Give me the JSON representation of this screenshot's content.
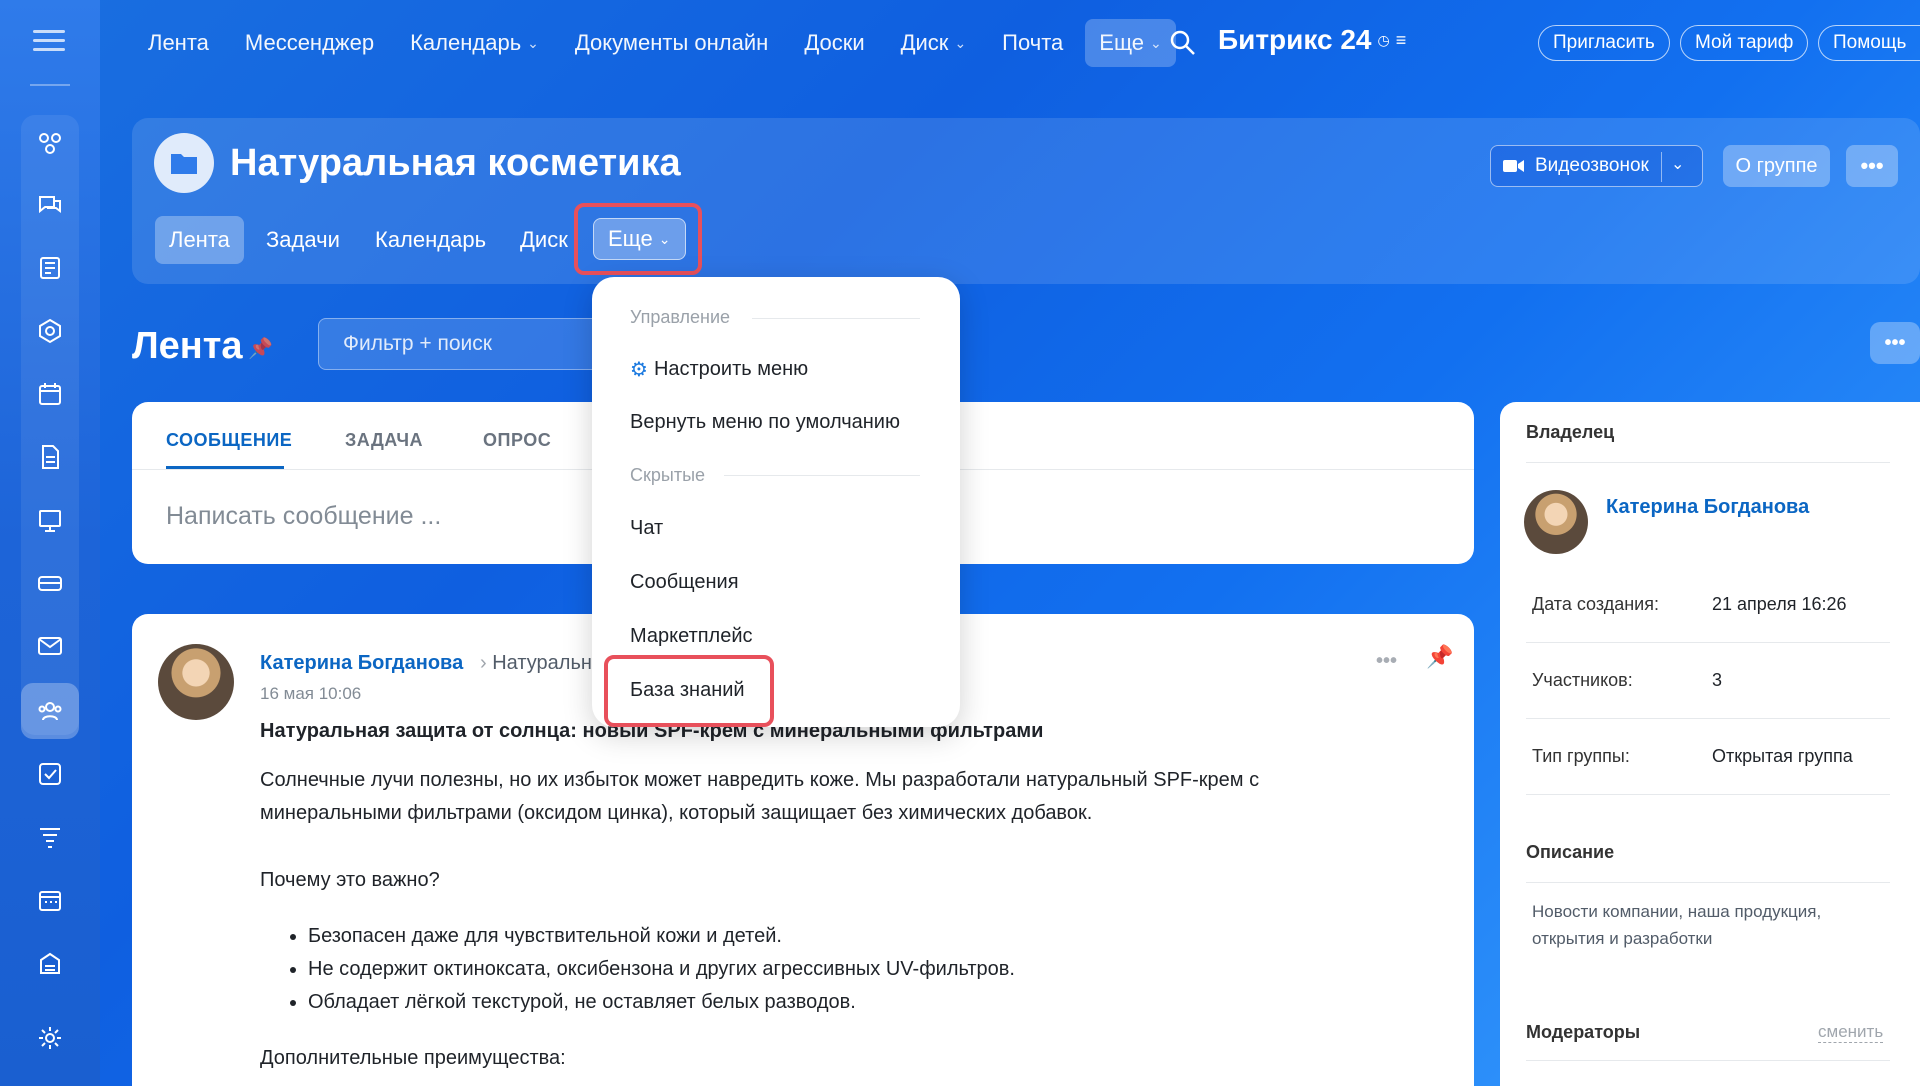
{
  "topnav": {
    "items": [
      {
        "label": "Лента"
      },
      {
        "label": "Мессенджер"
      },
      {
        "label": "Календарь",
        "chevron": true
      },
      {
        "label": "Документы онлайн"
      },
      {
        "label": "Доски"
      },
      {
        "label": "Диск",
        "chevron": true
      },
      {
        "label": "Почта"
      }
    ],
    "more_label": "Еще",
    "brand": "Битрикс 24",
    "invite": "Пригласить",
    "tariff": "Мой тариф",
    "help": "Помощь"
  },
  "group": {
    "title": "Натуральная косметика",
    "tabs": [
      "Лента",
      "Задачи",
      "Календарь",
      "Диск"
    ],
    "more_label": "Еще",
    "video_call": "Видеозвонок",
    "about": "О группе"
  },
  "feed": {
    "title": "Лента",
    "filter_placeholder": "Фильтр + поиск"
  },
  "composer": {
    "tabs": [
      "СООБЩЕНИЕ",
      "ЗАДАЧА",
      "ОПРОС"
    ],
    "placeholder": "Написать сообщение ..."
  },
  "post": {
    "author": "Катерина Богданова",
    "crumb": "Натуральн",
    "date": "16 мая 10:06",
    "title": "Натуральная защита от солнца: новый SPF-крем с минеральными фильтрами",
    "para1_line1": "Солнечные лучи полезны, но их избыток может навредить коже. Мы разработали натуральный SPF-крем с",
    "para1_line2": "минеральными фильтрами (оксидом цинка), который защищает без химических добавок.",
    "question": "Почему это важно?",
    "bullets": [
      "Безопасен даже для чувствительной кожи и детей.",
      "Не содержит октиноксата, оксибензона и других агрессивных UV-фильтров.",
      "Обладает лёгкой текстурой, не оставляет белых разводов."
    ],
    "extra": "Дополнительные преимущества:"
  },
  "panel": {
    "owner_label": "Владелец",
    "owner_name": "Катерина Богданова",
    "created_key": "Дата создания:",
    "created_val": "21 апреля 16:26",
    "members_key": "Участников:",
    "members_val": "3",
    "type_key": "Тип группы:",
    "type_val": "Открытая группа",
    "desc_label": "Описание",
    "desc_text": "Новости компании, наша продукция, открытия и разработки",
    "moderators_label": "Модераторы",
    "change_link": "сменить"
  },
  "dropdown": {
    "section_manage": "Управление",
    "configure_menu": "Настроить меню",
    "reset_menu": "Вернуть меню по умолчанию",
    "section_hidden": "Скрытые",
    "hidden_items": [
      "Чат",
      "Сообщения",
      "Маркетплейс",
      "База знаний"
    ]
  },
  "colors": {
    "accent": "#0b66c3",
    "highlight": "#e8505b"
  }
}
